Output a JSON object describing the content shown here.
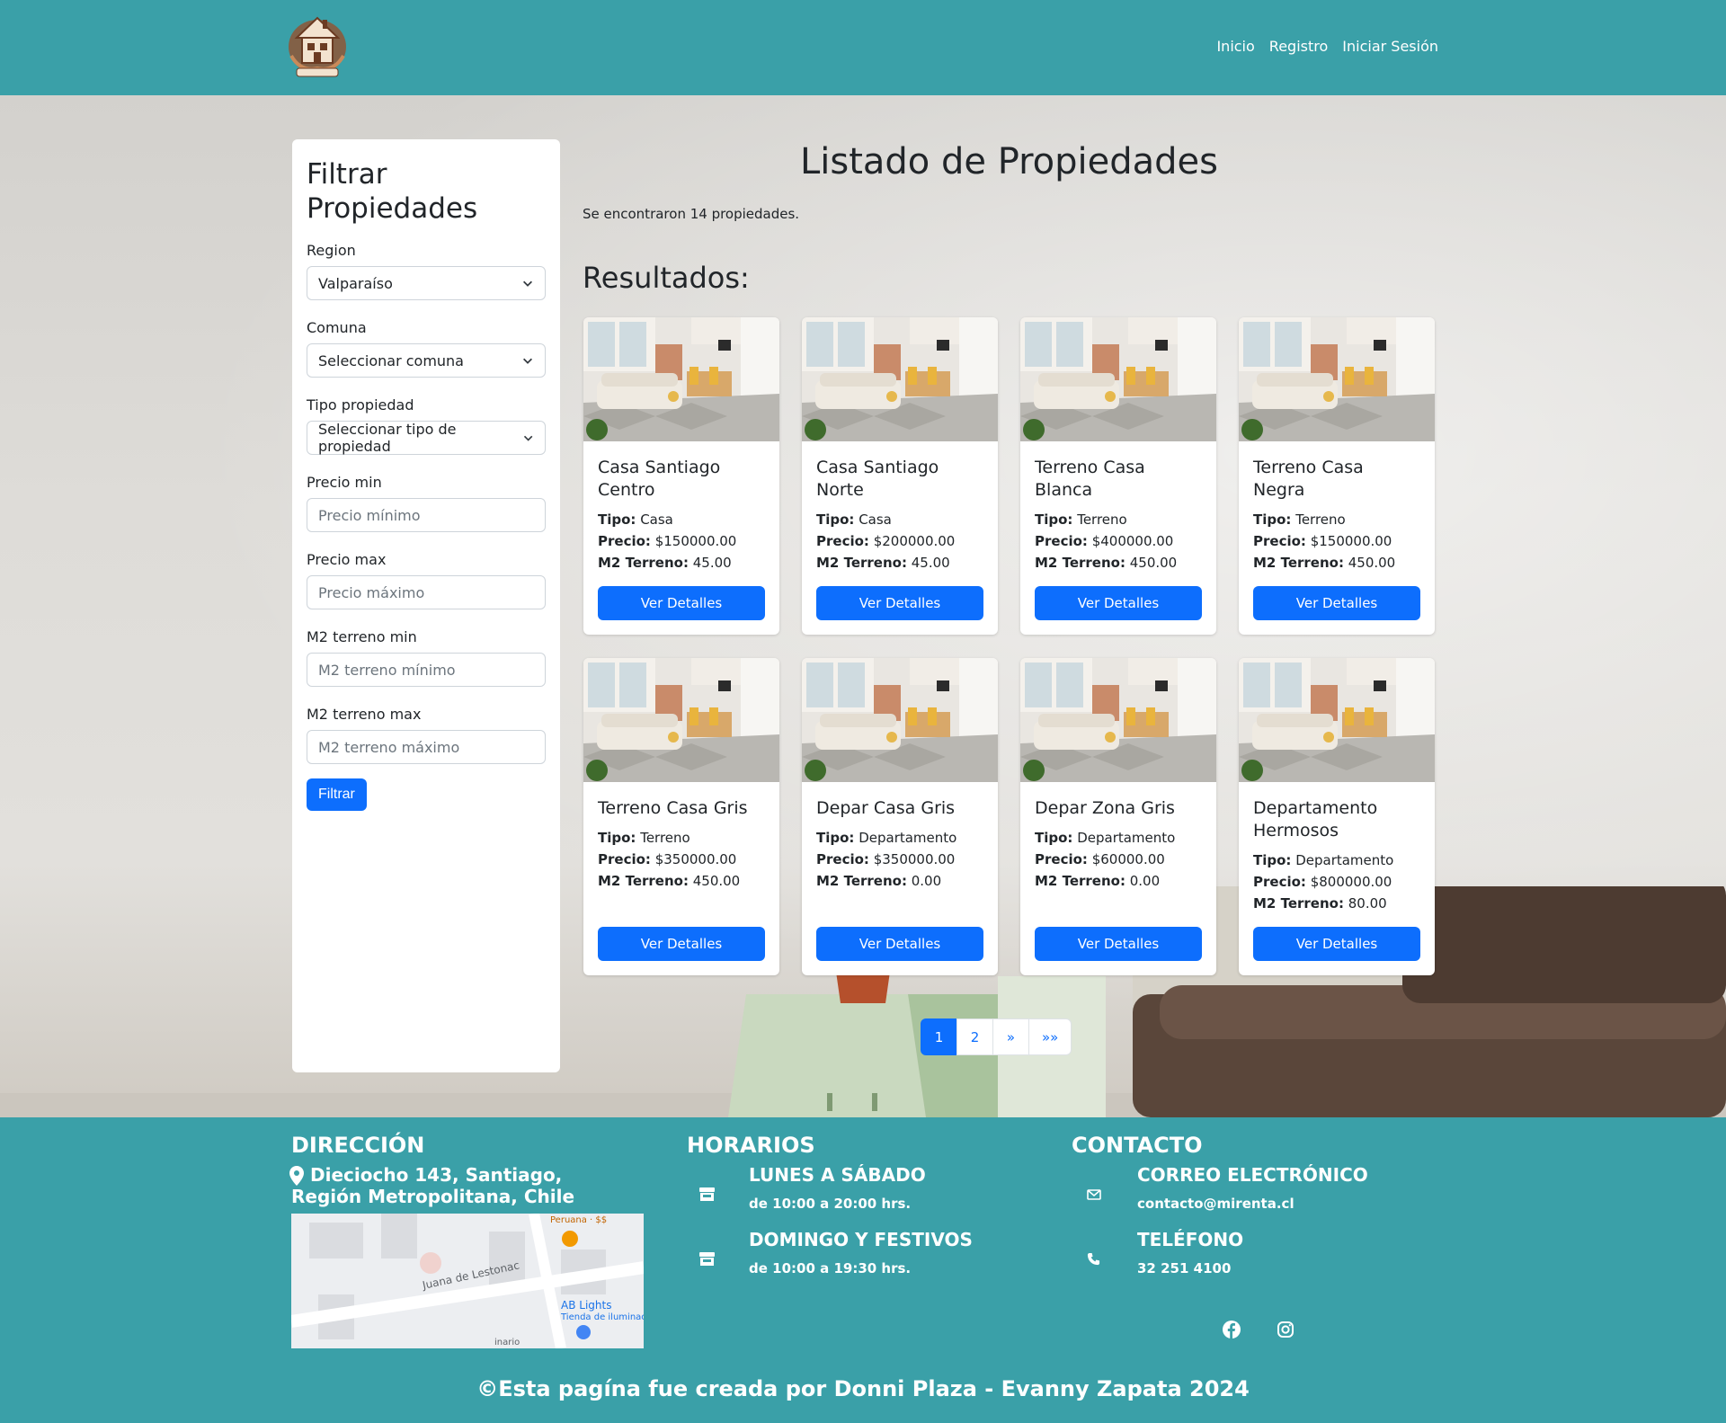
{
  "nav": {
    "links": [
      "Inicio",
      "Registro",
      "Iniciar Sesión"
    ],
    "logo_text": "MI RENTA"
  },
  "sidebar": {
    "title": "Filtrar Propiedades",
    "region_label": "Region",
    "region_value": "Valparaíso",
    "comuna_label": "Comuna",
    "comuna_value": "Seleccionar comuna",
    "tipo_label": "Tipo propiedad",
    "tipo_value": "Seleccionar tipo de propiedad",
    "precio_min_label": "Precio min",
    "precio_min_placeholder": "Precio mínimo",
    "precio_max_label": "Precio max",
    "precio_max_placeholder": "Precio máximo",
    "m2_min_label": "M2 terreno min",
    "m2_min_placeholder": "M2 terreno mínimo",
    "m2_max_label": "M2 terreno max",
    "m2_max_placeholder": "M2 terreno máximo",
    "filter_button": "Filtrar"
  },
  "main": {
    "title": "Listado de Propiedades",
    "found_text": "Se encontraron 14 propiedades.",
    "results_title": "Resultados:",
    "labels": {
      "tipo": "Tipo:",
      "precio": "Precio:",
      "m2": "M2 Terreno:"
    },
    "detail_button": "Ver Detalles",
    "cards": [
      {
        "title": "Casa Santiago Centro",
        "tipo": "Casa",
        "precio": "$150000.00",
        "m2": "45.00"
      },
      {
        "title": "Casa Santiago Norte",
        "tipo": "Casa",
        "precio": "$200000.00",
        "m2": "45.00"
      },
      {
        "title": "Terreno Casa Blanca",
        "tipo": "Terreno",
        "precio": "$400000.00",
        "m2": "450.00"
      },
      {
        "title": "Terreno Casa Negra",
        "tipo": "Terreno",
        "precio": "$150000.00",
        "m2": "450.00"
      },
      {
        "title": "Terreno Casa Gris",
        "tipo": "Terreno",
        "precio": "$350000.00",
        "m2": "450.00"
      },
      {
        "title": "Depar Casa Gris",
        "tipo": "Departamento",
        "precio": "$350000.00",
        "m2": "0.00"
      },
      {
        "title": "Depar Zona Gris",
        "tipo": "Departamento",
        "precio": "$60000.00",
        "m2": "0.00"
      },
      {
        "title": "Departamento Hermosos",
        "tipo": "Departamento",
        "precio": "$800000.00",
        "m2": "80.00"
      }
    ],
    "pagination": [
      "1",
      "2",
      "»",
      "»»"
    ]
  },
  "footer": {
    "direccion_title": "DIRECCIÓN",
    "address": "Dieciocho 143, Santiago, Región Metropolitana, Chile",
    "map_labels": [
      "Juana de Lestonac",
      "Peruana · $$",
      "AB Lights",
      "Tienda de iluminac",
      "inario"
    ],
    "horarios_title": "HORARIOS",
    "horario1_title": "LUNES A SÁBADO",
    "horario1_text": "de 10:00 a 20:00 hrs.",
    "horario2_title": "DOMINGO Y FESTIVOS",
    "horario2_text": "de 10:00 a 19:30 hrs.",
    "contacto_title": "CONTACTO",
    "email_title": "CORREO ELECTRÓNICO",
    "email": "contacto@mirenta.cl",
    "phone_title": "TELÉFONO",
    "phone": "32 251 4100",
    "copyright": "©Esta pagína fue creada por Donni Plaza - Evanny Zapata 2024"
  },
  "colors": {
    "primary": "#0d6efd",
    "teal": "#3aa0a8"
  },
  "icons": [
    "logo-house-icon",
    "chevron-down-icon",
    "map-marker-icon",
    "store-icon",
    "envelope-icon",
    "phone-icon",
    "facebook-icon",
    "instagram-icon"
  ]
}
